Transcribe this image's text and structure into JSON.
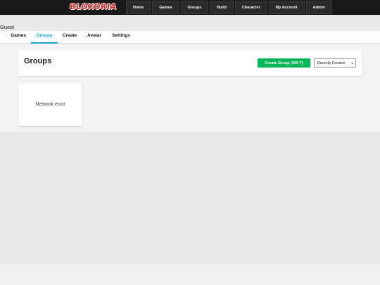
{
  "app": {
    "logo_text": "BLOXORIA"
  },
  "topnav": {
    "items": [
      {
        "label": "Home"
      },
      {
        "label": "Games"
      },
      {
        "label": "Groups"
      },
      {
        "label": "Build"
      },
      {
        "label": "Character"
      },
      {
        "label": "My Account"
      },
      {
        "label": "Admin"
      }
    ]
  },
  "user": {
    "name": "Guest"
  },
  "subnav": {
    "items": [
      {
        "label": "Games"
      },
      {
        "label": "Groups"
      },
      {
        "label": "Create"
      },
      {
        "label": "Avatar"
      },
      {
        "label": "Settings"
      }
    ],
    "active": "Groups"
  },
  "groups": {
    "title": "Groups",
    "create_label": "Create Group (300 T)",
    "sort_value": "Recently Created",
    "error": "Network error"
  },
  "colors": {
    "topbar": "#191919",
    "accent": "#1aa7d8",
    "create_button": "#02b757",
    "logo": "#e02424"
  }
}
